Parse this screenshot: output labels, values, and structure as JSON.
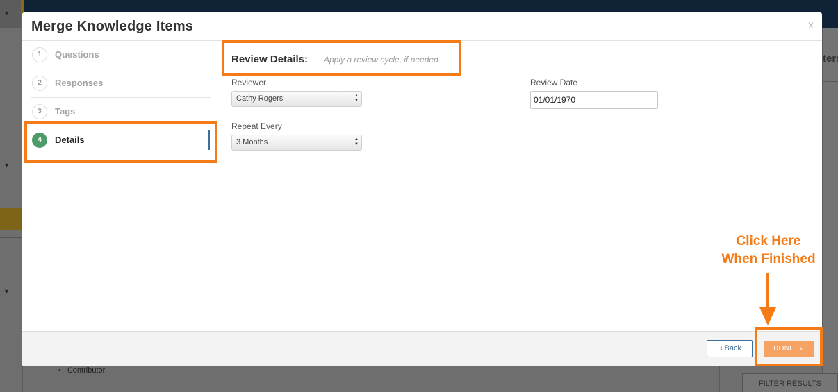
{
  "background": {
    "right_panel_text": "ters",
    "bullet_item": "Contributor",
    "filter_button": "FILTER RESULTS"
  },
  "modal": {
    "title": "Merge Knowledge Items",
    "close_label": "x",
    "steps": [
      {
        "number": "1",
        "label": "Questions",
        "active": false
      },
      {
        "number": "2",
        "label": "Responses",
        "active": false
      },
      {
        "number": "3",
        "label": "Tags",
        "active": false
      },
      {
        "number": "4",
        "label": "Details",
        "active": true
      }
    ],
    "section": {
      "title": "Review Details:",
      "subtitle": "Apply a review cycle, if needed"
    },
    "fields": {
      "reviewer": {
        "label": "Reviewer",
        "value": "Cathy Rogers"
      },
      "repeat_every": {
        "label": "Repeat Every",
        "value": "3 Months"
      },
      "review_date": {
        "label": "Review Date",
        "value": "01/01/1970"
      }
    },
    "footer": {
      "back_label": "Back",
      "done_label": "DONE"
    }
  },
  "annotation": {
    "callout_line1": "Click Here",
    "callout_line2": "When Finished",
    "highlight_color": "#f47b16"
  },
  "colors": {
    "active_step": "#4f9a6b",
    "done_button": "#f5a262",
    "back_button": "#3f6e9a",
    "top_bar": "#0f2236"
  }
}
